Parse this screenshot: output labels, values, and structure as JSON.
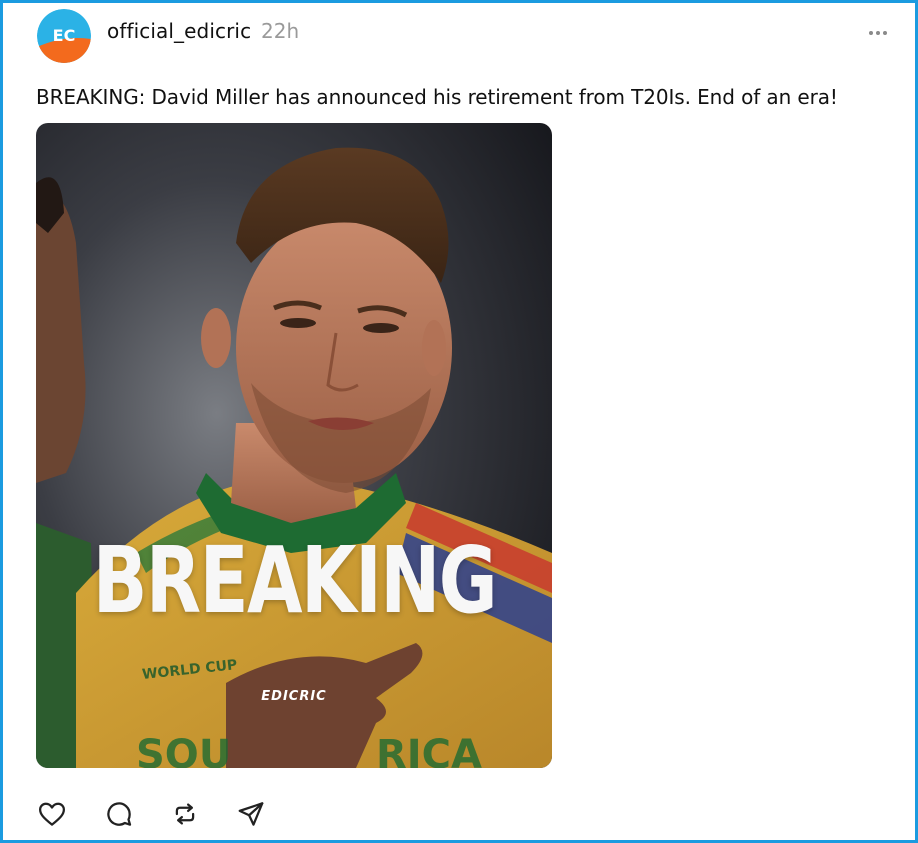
{
  "post": {
    "avatar_initials": "EC",
    "username": "official_edicric",
    "time": "22h",
    "more_icon": "more-horizontal-icon",
    "caption": "BREAKING: David Miller has announced his retirement from T20Is. End of an era!",
    "image": {
      "overlay_title": "BREAKING",
      "brand_mark": "EDICRIC",
      "shirt_text": "WORLD CUP"
    }
  },
  "actions": [
    {
      "name": "like",
      "icon": "heart-icon"
    },
    {
      "name": "reply",
      "icon": "comment-icon"
    },
    {
      "name": "repost",
      "icon": "repost-icon"
    },
    {
      "name": "share",
      "icon": "send-icon"
    }
  ],
  "colors": {
    "window_border": "#1b9be0",
    "avatar_top": "#2bb2e6",
    "avatar_bottom": "#f36a1d",
    "shirt_gold": "#d4a433",
    "shirt_green": "#1e6b32"
  }
}
